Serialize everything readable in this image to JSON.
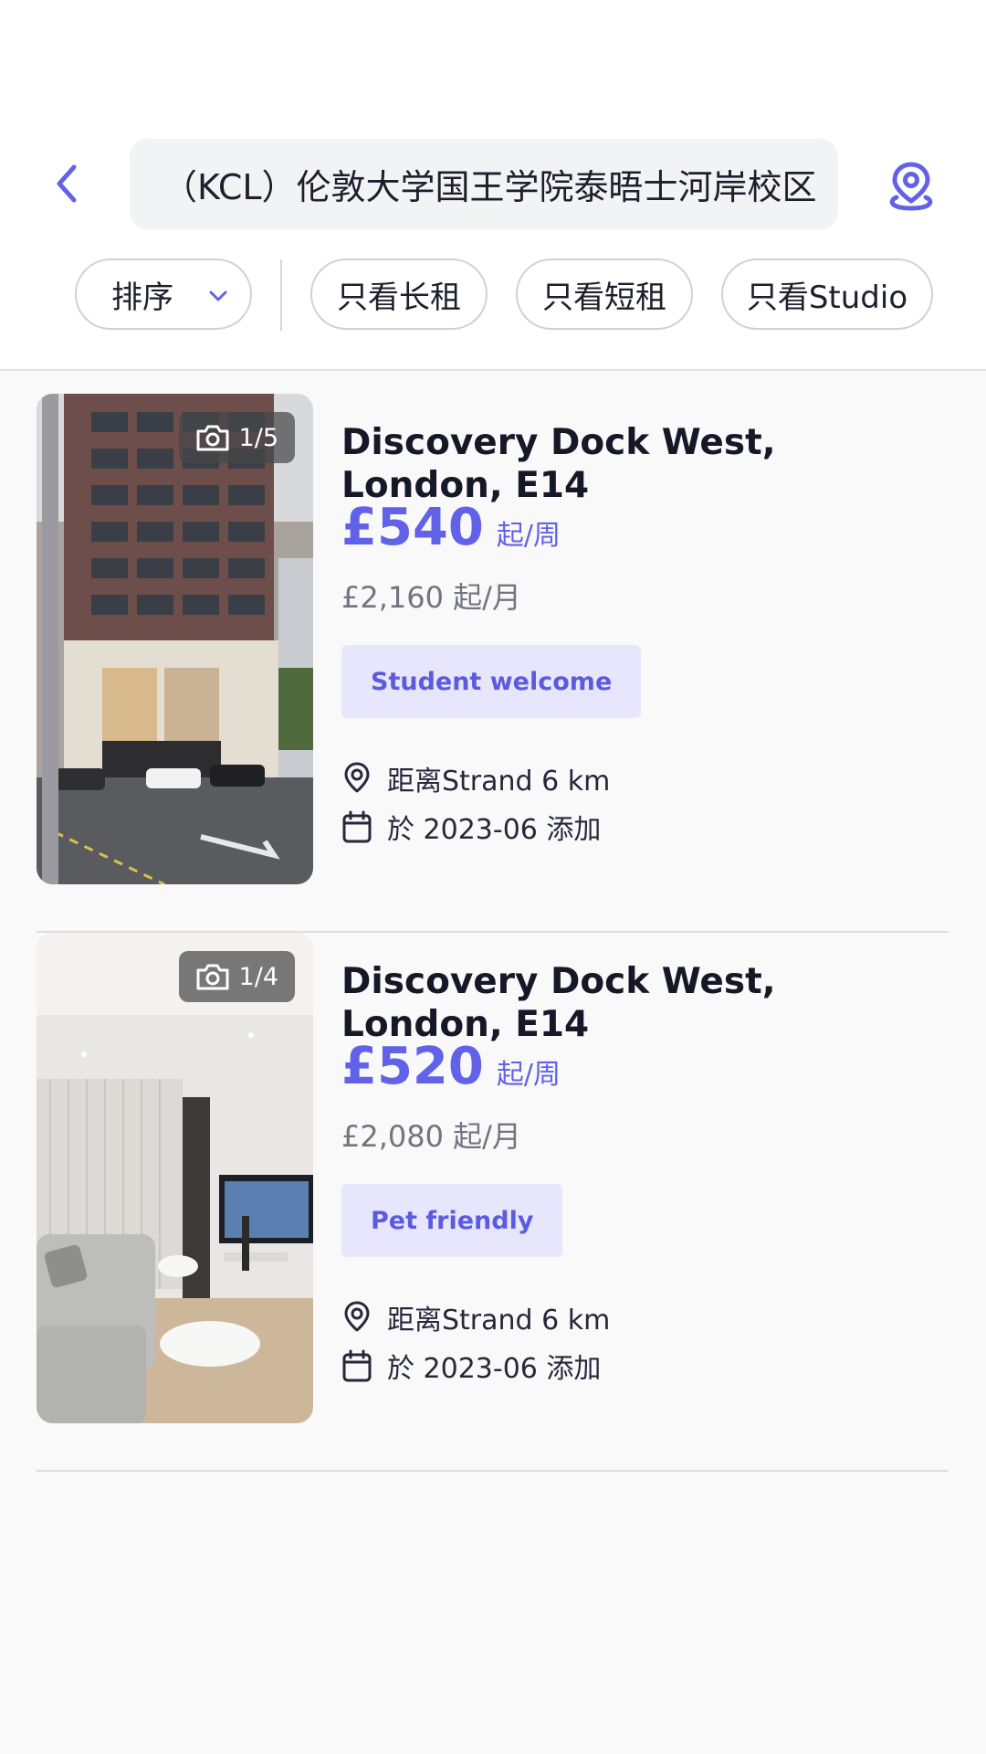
{
  "header": {
    "search_text": "（KCL）伦敦大学国王学院泰晤士河岸校区"
  },
  "filters": {
    "sort_label": "排序",
    "chips": [
      "只看长租",
      "只看短租",
      "只看Studio"
    ]
  },
  "listings": [
    {
      "photo_count": "1/5",
      "title": "Discovery Dock West, London, E14",
      "price": "£540",
      "price_unit": "起/周",
      "monthly": "£2,160 起/月",
      "tag": "Student welcome",
      "distance": "距离Strand 6 km",
      "added": "於 2023-06 添加"
    },
    {
      "photo_count": "1/4",
      "title": "Discovery Dock West, London, E14",
      "price": "£520",
      "price_unit": "起/周",
      "monthly": "£2,080 起/月",
      "tag": "Pet friendly",
      "distance": "距离Strand 6 km",
      "added": "於 2023-06 添加"
    }
  ],
  "colors": {
    "accent": "#6262e8",
    "tag_bg": "#e7e6fd",
    "page_bg": "#f9f9fa"
  },
  "icons": [
    "back-arrow-icon",
    "map-pin-icon",
    "chevron-down-icon",
    "camera-icon",
    "location-icon",
    "calendar-icon"
  ]
}
